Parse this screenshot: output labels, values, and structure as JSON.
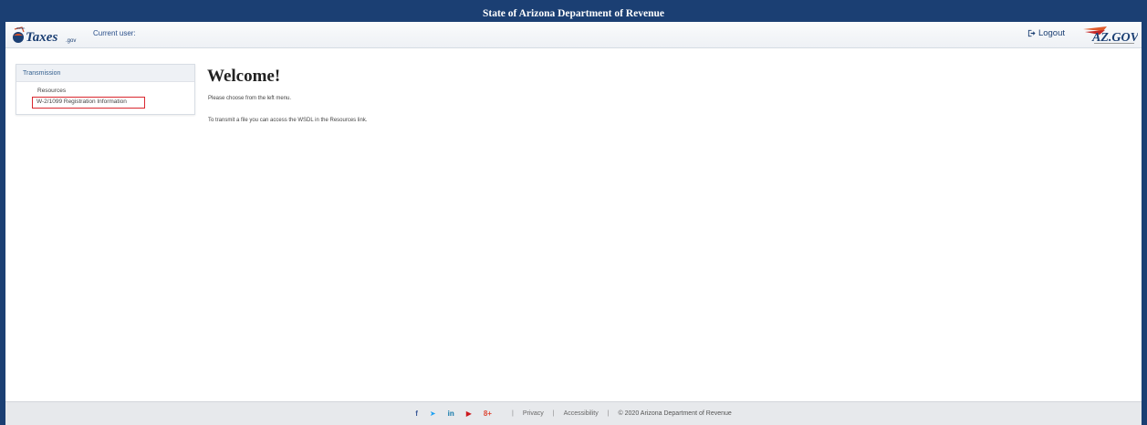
{
  "window": {
    "title": "State of Arizona Department of Revenue"
  },
  "header": {
    "current_user_label": "Current user:",
    "logout_label": "Logout",
    "brand_color": "#1b3f73"
  },
  "sidebar": {
    "heading": "Transmission",
    "items": [
      {
        "label": "Resources"
      },
      {
        "label": "W-2/1099 Registration Information"
      }
    ]
  },
  "main": {
    "title": "Welcome!",
    "line1": "Please choose from the left menu.",
    "line2": "To transmit a file you can access the WSDL in the Resources link."
  },
  "footer": {
    "social_icons": [
      "facebook-icon",
      "twitter-icon",
      "linkedin-icon",
      "youtube-icon",
      "google-plus-icon"
    ],
    "privacy": "Privacy",
    "accessibility": "Accessibility",
    "copyright": "© 2020 Arizona Department of Revenue",
    "separator": "|"
  }
}
